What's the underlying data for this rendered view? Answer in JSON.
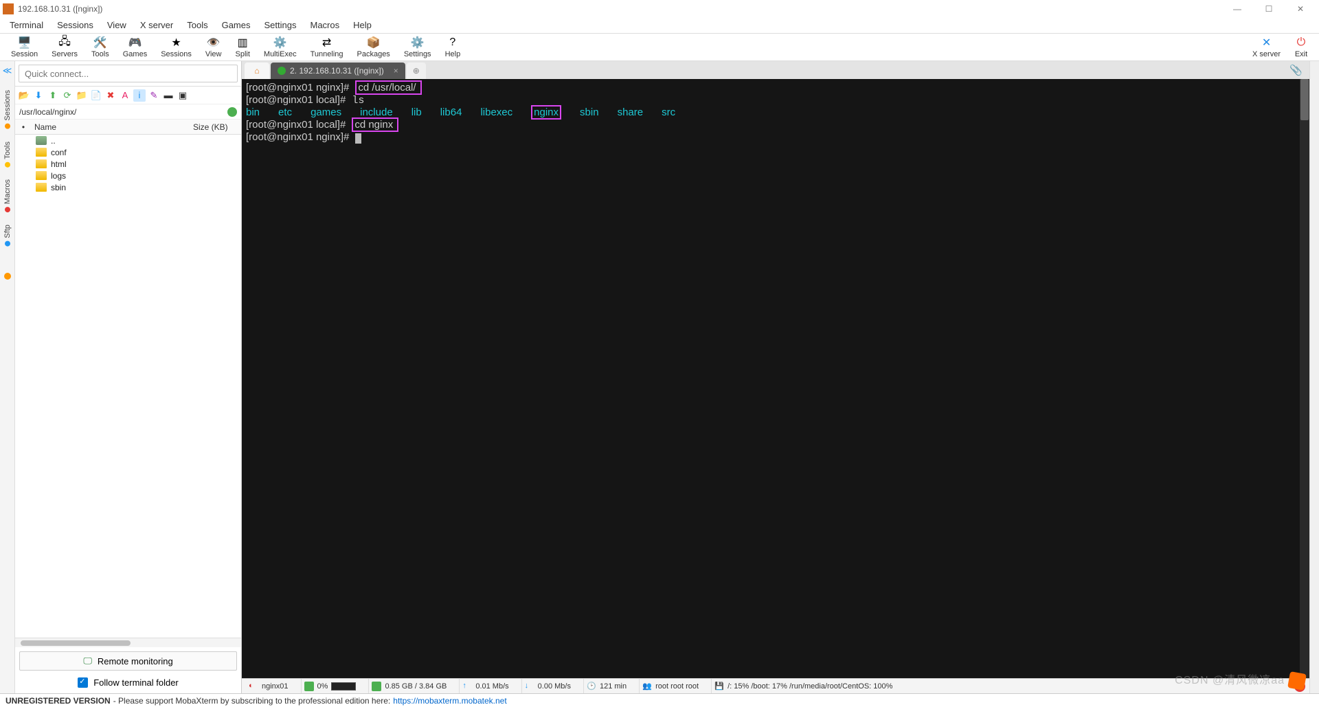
{
  "window": {
    "title": "192.168.10.31 ([nginx])"
  },
  "menu": [
    "Terminal",
    "Sessions",
    "View",
    "X server",
    "Tools",
    "Games",
    "Settings",
    "Macros",
    "Help"
  ],
  "toolbar": {
    "left": [
      {
        "name": "session-button",
        "icon": "🖥️",
        "label": "Session"
      },
      {
        "name": "servers-button",
        "icon": "🖧",
        "label": "Servers"
      },
      {
        "name": "tools-button",
        "icon": "🛠️",
        "label": "Tools"
      },
      {
        "name": "games-button",
        "icon": "🎮",
        "label": "Games"
      },
      {
        "name": "sessions-button",
        "icon": "★",
        "label": "Sessions"
      },
      {
        "name": "view-button",
        "icon": "👁️",
        "label": "View"
      },
      {
        "name": "split-button",
        "icon": "▥",
        "label": "Split"
      },
      {
        "name": "multiexec-button",
        "icon": "⚙️",
        "label": "MultiExec"
      },
      {
        "name": "tunneling-button",
        "icon": "⇄",
        "label": "Tunneling"
      },
      {
        "name": "packages-button",
        "icon": "📦",
        "label": "Packages"
      },
      {
        "name": "settings-button",
        "icon": "⚙️",
        "label": "Settings"
      },
      {
        "name": "help-button",
        "icon": "?",
        "label": "Help"
      }
    ],
    "right": [
      {
        "name": "xserver-button",
        "icon": "✕",
        "label": "X server",
        "color": "#1e88e5"
      },
      {
        "name": "exit-button",
        "icon": "⏻",
        "label": "Exit",
        "color": "#e53935"
      }
    ]
  },
  "quick": {
    "placeholder": "Quick connect..."
  },
  "leftstrip": [
    "Sessions",
    "Tools",
    "Macros",
    "Sftp"
  ],
  "filepanel": {
    "path": "/usr/local/nginx/",
    "headers": {
      "name": "Name",
      "size": "Size (KB)"
    },
    "items": [
      {
        "type": "up",
        "name": ".."
      },
      {
        "type": "folder",
        "name": "conf"
      },
      {
        "type": "folder",
        "name": "html"
      },
      {
        "type": "folder",
        "name": "logs"
      },
      {
        "type": "folder",
        "name": "sbin"
      }
    ],
    "monitor_label": "Remote monitoring",
    "follow_label": "Follow terminal folder"
  },
  "tabs": {
    "active": {
      "label": "2. 192.168.10.31 ([nginx])"
    }
  },
  "terminal": {
    "lines": [
      {
        "prompt": "[root@nginx01 nginx]#",
        "cmd": "cd /usr/local/",
        "box": true
      },
      {
        "prompt": "[root@nginx01 local]#",
        "cmd": "ls"
      },
      {
        "dirs": [
          "bin",
          "etc",
          "games",
          "include",
          "lib",
          "lib64",
          "libexec",
          "nginx",
          "sbin",
          "share",
          "src"
        ],
        "box_item": "nginx"
      },
      {
        "prompt": "[root@nginx01 local]#",
        "cmd": "cd nginx",
        "box": true
      },
      {
        "prompt": "[root@nginx01 nginx]#",
        "cursor": true
      }
    ]
  },
  "status": {
    "host": "nginx01",
    "cpu": "0%",
    "mem": "0.85 GB / 3.84 GB",
    "up": "0.01 Mb/s",
    "down": "0.00 Mb/s",
    "uptime": "121 min",
    "users": "root  root  root",
    "disks": "/: 15%   /boot: 17%   /run/media/root/CentOS: 100%"
  },
  "footer": {
    "bold": "UNREGISTERED VERSION",
    "text": "  -   Please support MobaXterm by subscribing to the professional edition here:  ",
    "link": "https://mobaxterm.mobatek.net"
  },
  "watermark": "CSDN @清风微凉aa"
}
